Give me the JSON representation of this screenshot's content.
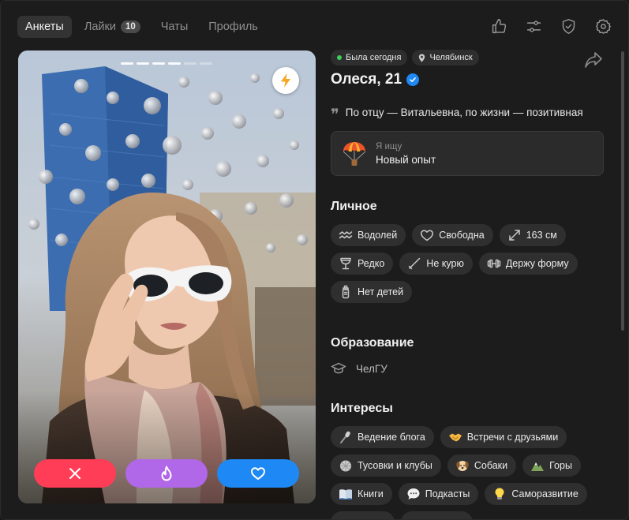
{
  "nav": {
    "tabs": [
      {
        "label": "Анкеты",
        "active": true
      },
      {
        "label": "Лайки",
        "badge": "10"
      },
      {
        "label": "Чаты"
      },
      {
        "label": "Профиль"
      }
    ],
    "icons": [
      "thumbs-up-icon",
      "sliders-icon",
      "shield-check-icon",
      "settings-gear-icon"
    ]
  },
  "photo": {
    "slide_count": 6,
    "active_slides": 4,
    "boost_icon": "lightning-bolt-icon",
    "actions": [
      {
        "name": "dislike-button",
        "icon": "close-icon",
        "color": "#ff3d56"
      },
      {
        "name": "superlike-button",
        "icon": "flame-icon",
        "color": "#b067e8"
      },
      {
        "name": "like-button",
        "icon": "heart-icon",
        "color": "#1e88f5"
      }
    ]
  },
  "profile": {
    "status": "Была сегодня",
    "city": "Челябинск",
    "name_age": "Олеся, 21",
    "bio": "По отцу — Витальевна, по жизни — позитивная",
    "seeking": {
      "label": "Я ищу",
      "value": "Новый опыт",
      "icon": "parachute-icon"
    }
  },
  "personal": {
    "title": "Личное",
    "chips": [
      {
        "label": "Водолей",
        "icon": "aquarius-icon"
      },
      {
        "label": "Свободна",
        "icon": "heart-outline-icon"
      },
      {
        "label": "163 см",
        "icon": "height-arrows-icon"
      },
      {
        "label": "Редко",
        "icon": "wine-glass-icon"
      },
      {
        "label": "Не курю",
        "icon": "no-smoking-icon"
      },
      {
        "label": "Держу форму",
        "icon": "dumbbell-icon"
      },
      {
        "label": "Нет детей",
        "icon": "baby-bottle-icon"
      }
    ]
  },
  "education": {
    "title": "Образование",
    "value": "ЧелГУ"
  },
  "interests": {
    "title": "Интересы",
    "chips": [
      {
        "label": "Ведение блога",
        "icon": "microphone-emoji-icon"
      },
      {
        "label": "Встречи с друзьями",
        "icon": "handshake-emoji-icon"
      },
      {
        "label": "Тусовки и клубы",
        "icon": "disco-emoji-icon"
      },
      {
        "label": "Собаки",
        "icon": "dog-emoji-icon"
      },
      {
        "label": "Горы",
        "icon": "mountain-emoji-icon"
      },
      {
        "label": "Книги",
        "icon": "book-emoji-icon"
      },
      {
        "label": "Подкасты",
        "icon": "speech-bubble-emoji-icon"
      },
      {
        "label": "Саморазвитие",
        "icon": "lightbulb-emoji-icon"
      }
    ]
  }
}
